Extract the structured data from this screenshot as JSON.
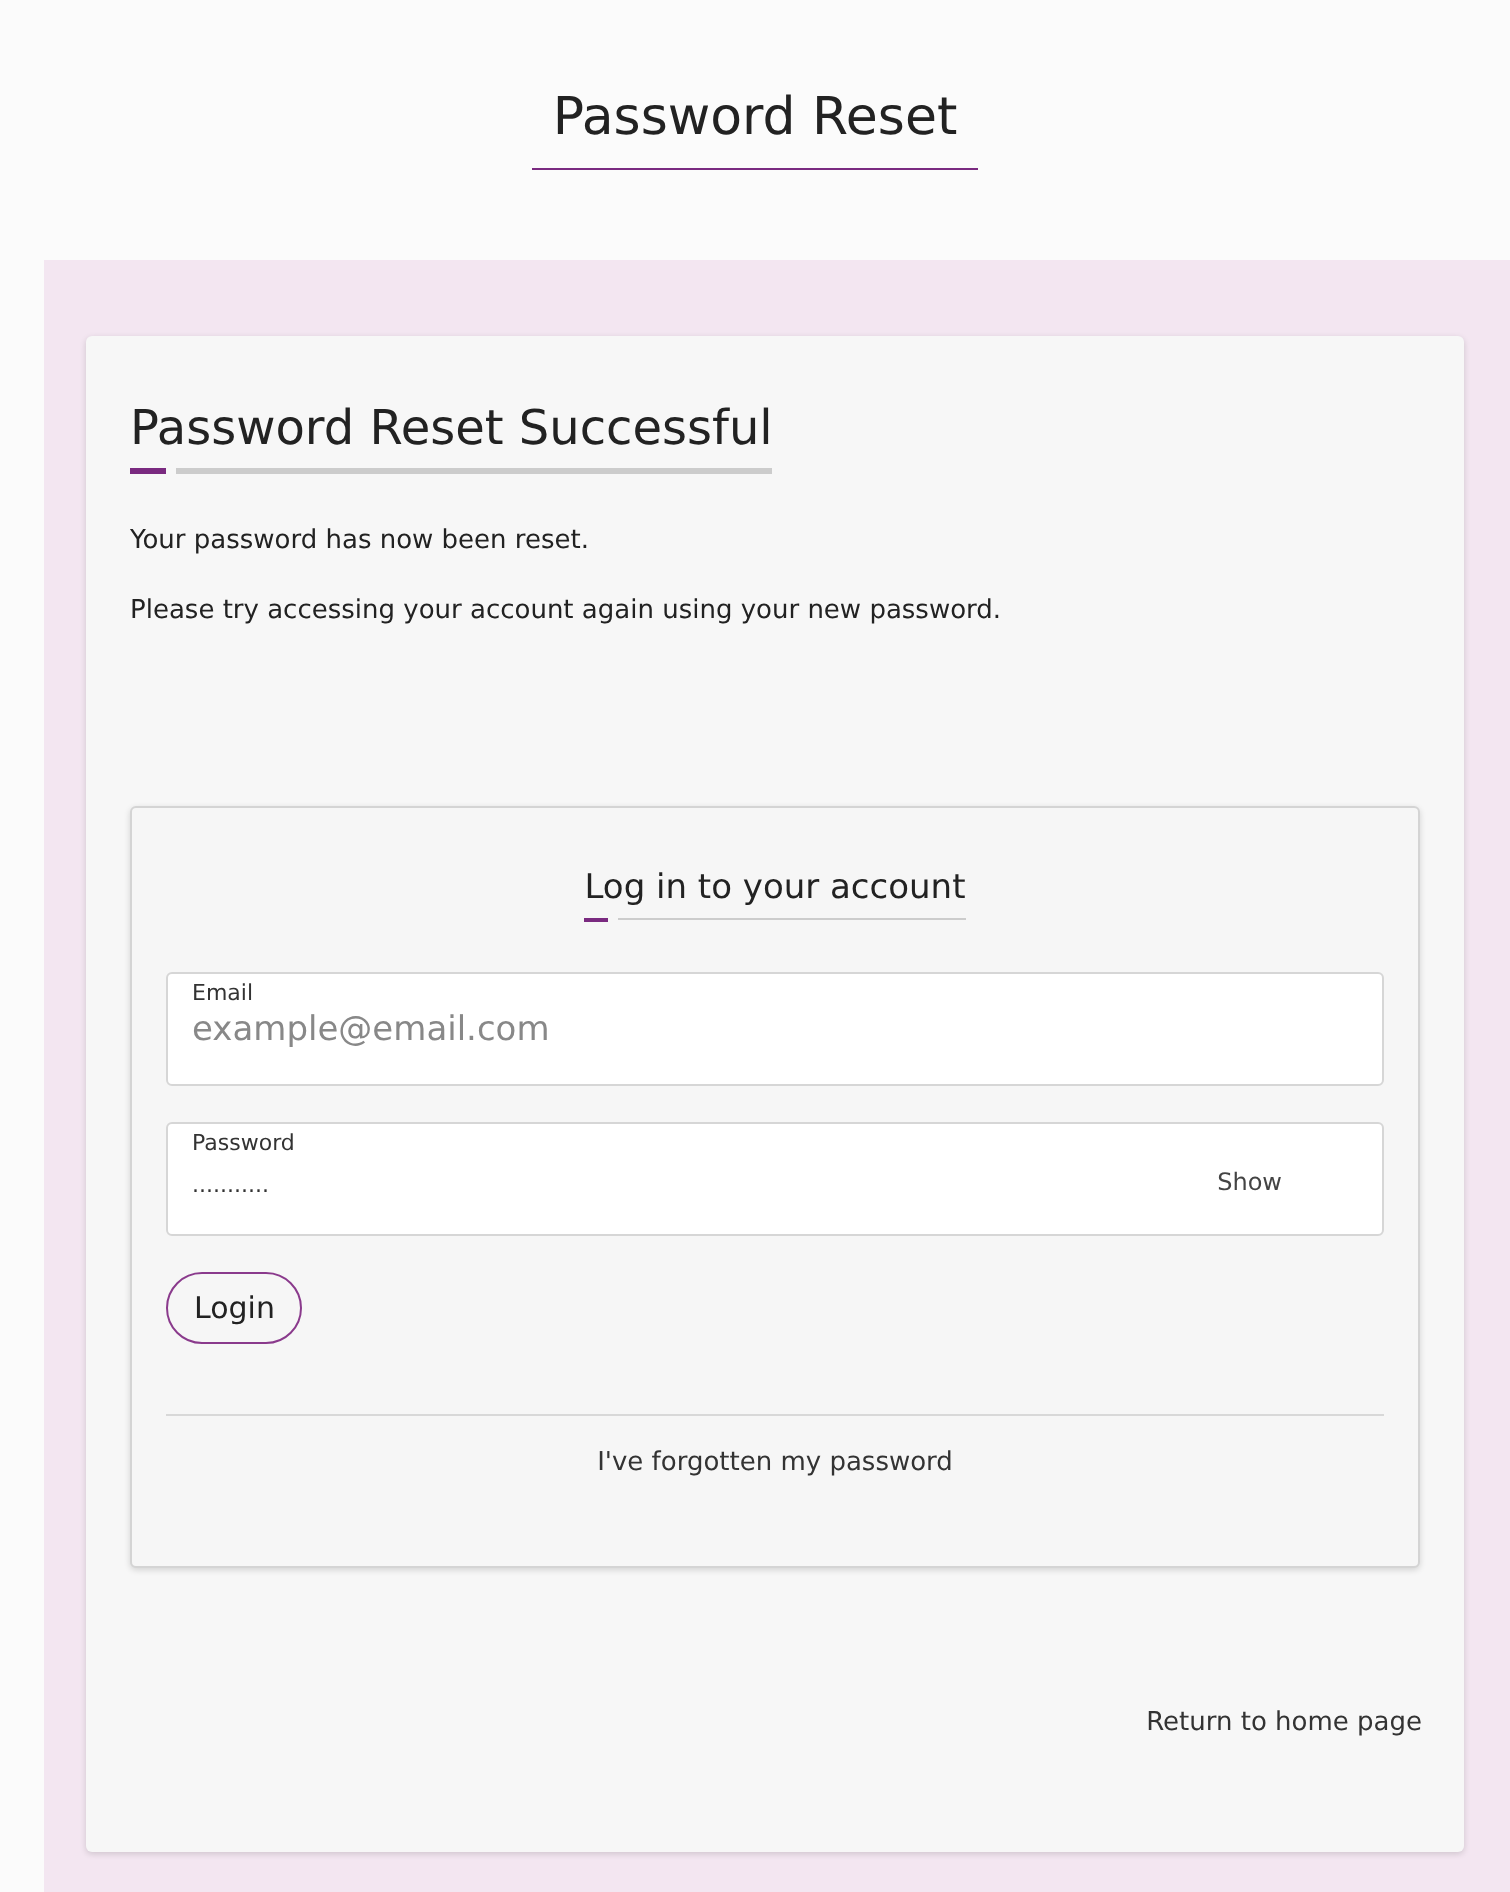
{
  "page_title": "Password Reset",
  "heading": "Password Reset Successful",
  "messages": [
    "Your password has now been reset.",
    "Please try accessing your account again using your new password."
  ],
  "login": {
    "title": "Log in to your account",
    "fields": [
      {
        "label": "Email",
        "placeholder": "example@email.com"
      },
      {
        "label": "Password",
        "value": "...........",
        "toggle": "Show"
      }
    ],
    "button": "Login",
    "forgot_link": "I've forgotten my password"
  },
  "home_link": "Return to home page"
}
